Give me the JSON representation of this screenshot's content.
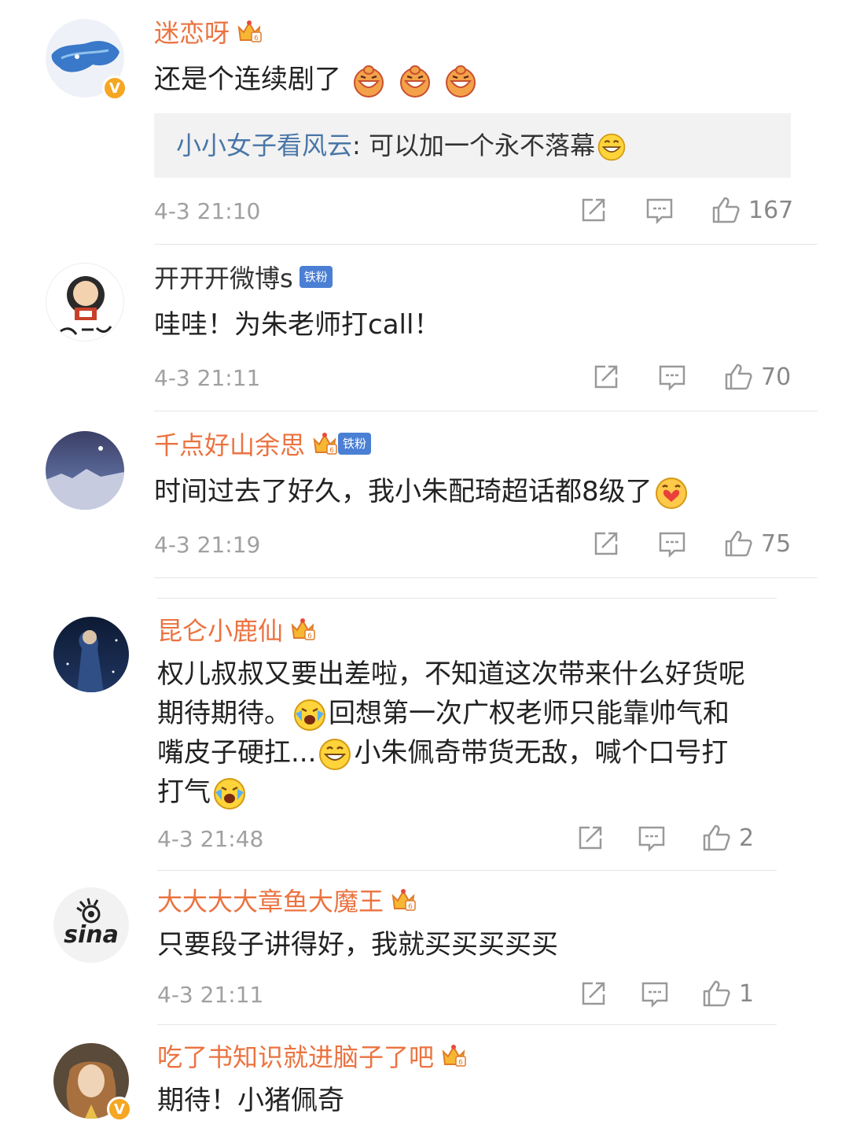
{
  "comments": [
    {
      "username": "迷恋呀",
      "text": "还是个连续剧了",
      "reply_name": "小小女子看风云",
      "reply_text": ": 可以加一个永不落幕",
      "time": "4-3 21:10",
      "likes": "167",
      "verified": "V"
    },
    {
      "username": "开开开微博s",
      "fan_badge": "铁粉",
      "text": "哇哇！为朱老师打call！",
      "time": "4-3 21:11",
      "likes": "70"
    },
    {
      "username": "千点好山余思",
      "fan_badge": "铁粉",
      "text": "时间过去了好久，我小朱配琦超话都8级了",
      "time": "4-3 21:19",
      "likes": "75"
    },
    {
      "username": "昆仑小鹿仙",
      "lines": [
        "权儿叔叔又要出差啦，不知道这次带来什么好货呢",
        "期待期待。",
        "回想第一次广权老师只能靠帅气和",
        "嘴皮子硬扛...",
        "小朱佩奇带货无敌，喊个口号打",
        "打气"
      ],
      "time": "4-3 21:48",
      "likes": "2"
    },
    {
      "username": "大大大大章鱼大魔王",
      "text": "只要段子讲得好，我就买买买买买",
      "time": "4-3 21:11",
      "likes": "1",
      "avatar_text": "sina"
    },
    {
      "username": "吃了书知识就进脑子了吧",
      "text": "期待！小猪佩奇",
      "verified": "V"
    }
  ]
}
